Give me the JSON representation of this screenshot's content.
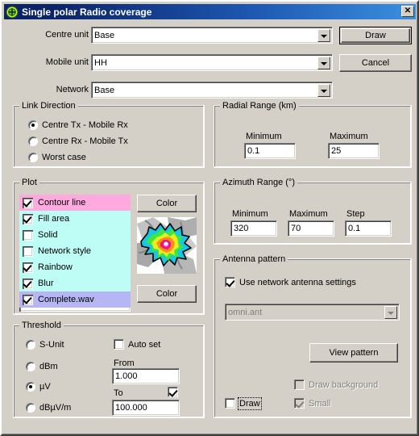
{
  "window": {
    "title": "Single polar Radio coverage",
    "icon": "radio-coverage-icon",
    "close_label": "✕"
  },
  "top_fields": [
    {
      "label": "Centre unit",
      "value": "Base",
      "name": "centre-unit"
    },
    {
      "label": "Mobile unit",
      "value": "HH",
      "name": "mobile-unit"
    },
    {
      "label": "Network",
      "value": "Base",
      "name": "network"
    }
  ],
  "buttons": {
    "draw": "Draw",
    "cancel": "Cancel"
  },
  "link_direction": {
    "title": "Link Direction",
    "options": [
      {
        "label": "Centre Tx - Mobile Rx",
        "checked": true
      },
      {
        "label": "Centre Rx - Mobile Tx",
        "checked": false
      },
      {
        "label": "Worst case",
        "checked": false
      }
    ]
  },
  "radial_range": {
    "title": "Radial Range (km)",
    "minimum_label": "Minimum",
    "minimum_value": "0.1",
    "maximum_label": "Maximum",
    "maximum_value": "25"
  },
  "plot": {
    "title": "Plot",
    "items": [
      {
        "label": "Contour line",
        "checked": true,
        "color": "#ffaade"
      },
      {
        "label": "Fill area",
        "checked": true,
        "color": "#bdfdf5"
      },
      {
        "label": "Solid",
        "checked": false,
        "color": "#bdfdf5"
      },
      {
        "label": "Network style",
        "checked": false,
        "color": "#bdfdf5"
      },
      {
        "label": "Rainbow",
        "checked": true,
        "color": "#bdfdf5"
      },
      {
        "label": "Blur",
        "checked": true,
        "color": "#bdfdf5"
      },
      {
        "label": "Complete.wav",
        "checked": true,
        "color": "#b6b6f5"
      }
    ],
    "color_button_top": "Color",
    "color_button_bottom": "Color",
    "preview_name": "coverage-preview-thumbnail"
  },
  "azimuth_range": {
    "title": "Azimuth Range (°)",
    "minimum_label": "Minimum",
    "minimum_value": "320",
    "maximum_label": "Maximum",
    "maximum_value": "70",
    "step_label": "Step",
    "step_value": "0.1"
  },
  "antenna_pattern": {
    "title": "Antenna pattern",
    "use_network_label": "Use network antenna settings",
    "use_network_checked": true,
    "pattern_file": "omni.ant",
    "view_pattern_label": "View pattern",
    "draw_background_label": "Draw background",
    "draw_background_checked": false,
    "small_label": "Small",
    "small_checked": true,
    "draw_label": "Draw",
    "draw_checked": false
  },
  "threshold": {
    "title": "Threshold",
    "units": [
      {
        "label": "S-Unit",
        "checked": false
      },
      {
        "label": "dBm",
        "checked": false
      },
      {
        "label": "µV",
        "checked": true
      },
      {
        "label": "dBµV/m",
        "checked": false
      }
    ],
    "auto_set_label": "Auto set",
    "auto_set_checked": false,
    "from_label": "From",
    "from_value": "1.000",
    "to_label": "To",
    "to_checked": true,
    "to_value": "100.000"
  },
  "colors": {
    "face": "#d4d0c8",
    "title_start": "#0a246a",
    "title_end": "#3a8fe0",
    "highlight_pink": "#ffaade",
    "highlight_cyan": "#bdfdf5",
    "highlight_lavender": "#b6b6f5"
  }
}
